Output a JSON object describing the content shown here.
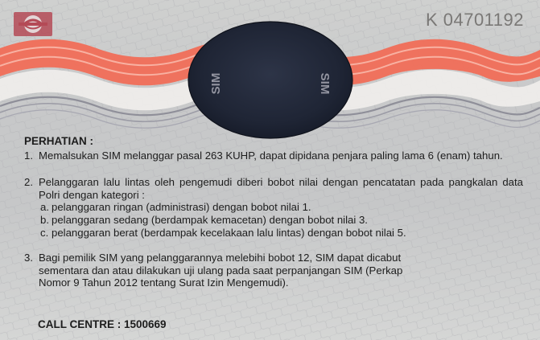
{
  "card": {
    "serial": "K 04701192",
    "logo_icon": "polri-traffic-emblem-icon",
    "oval": {
      "left_label": "SIM",
      "right_label": "SIM"
    },
    "colors": {
      "wave_red": "#f26a55",
      "wave_white": "#f3f1ee",
      "oval_dark": "#1f2535",
      "serial_gray": "#7a7876",
      "logo_red": "#b44a56"
    }
  },
  "notice": {
    "title": "PERHATIAN :",
    "items": [
      {
        "num": "1.",
        "text": "Memalsukan SIM melanggar pasal 263 KUHP, dapat dipidana penjara paling lama 6 (enam) tahun."
      },
      {
        "num": "2.",
        "text": "Pelanggaran lalu lintas oleh pengemudi diberi bobot nilai dengan pencatatan pada pangkalan data Polri dengan kategori :",
        "subitems": [
          {
            "letter": "a.",
            "text": "pelanggaran ringan (administrasi) dengan bobot nilai 1."
          },
          {
            "letter": "b.",
            "text": "pelanggaran sedang (berdampak kemacetan) dengan bobot nilai 3."
          },
          {
            "letter": "c.",
            "text": "pelanggaran berat (berdampak kecelakaan lalu lintas) dengan bobot nilai 5."
          }
        ]
      },
      {
        "num": "3.",
        "text": "Bagi pemilik SIM yang pelanggarannya melebihi bobot 12, SIM dapat dicabut sementara dan atau dilakukan uji ulang pada saat perpanjangan SIM (Perkap Nomor 9 Tahun 2012 tentang Surat Izin Mengemudi)."
      }
    ]
  },
  "call_centre": "CALL CENTRE : 1500669"
}
